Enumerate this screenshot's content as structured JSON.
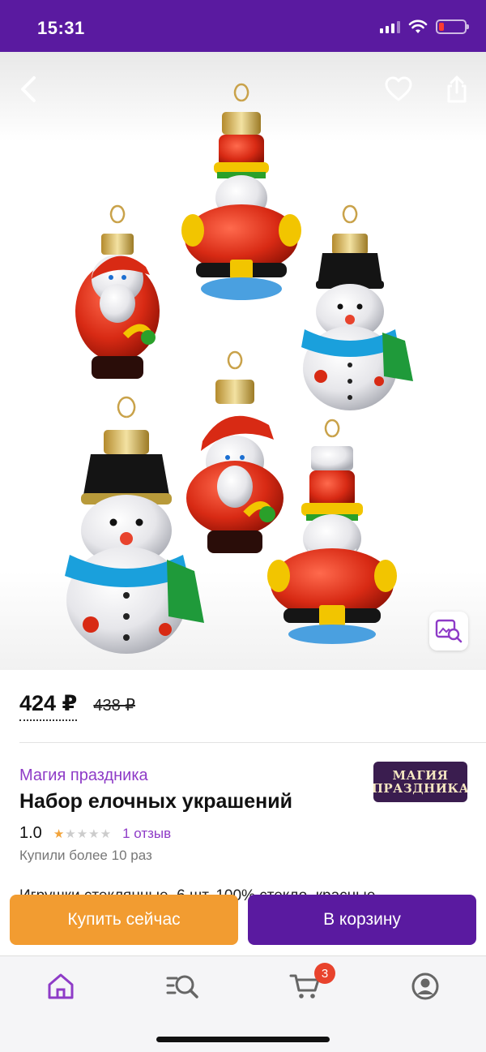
{
  "status_bar": {
    "time": "15:31"
  },
  "price": {
    "current": "424 ₽",
    "old": "438 ₽"
  },
  "product": {
    "seller": "Магия праздника",
    "title": "Набор елочных украшений",
    "rating": "1.0",
    "stars_filled": 1,
    "stars_total": 5,
    "reviews": "1 отзыв",
    "purchased": "Купили более 10 раз",
    "description_peek": "Игрушки стеклянные, 6 шт, 100% стекло, красные"
  },
  "seller_logo": {
    "line1": "МАГИЯ",
    "line2": "ПРАЗДНИКА"
  },
  "actions": {
    "buy_now": "Купить сейчас",
    "add_to_cart": "В корзину"
  },
  "tab_bar": {
    "cart_badge": "3"
  },
  "icons": {
    "back": "back-icon",
    "favorite": "heart-icon",
    "share": "share-icon",
    "visual_search": "image-search-icon",
    "home": "home-icon",
    "catalog": "catalog-search-icon",
    "cart": "cart-icon",
    "profile": "profile-icon"
  },
  "colors": {
    "brand_purple": "#5a1aa0",
    "accent_orange": "#f29c31",
    "seller_purple": "#8e3bc7",
    "badge_red": "#e8432d"
  }
}
